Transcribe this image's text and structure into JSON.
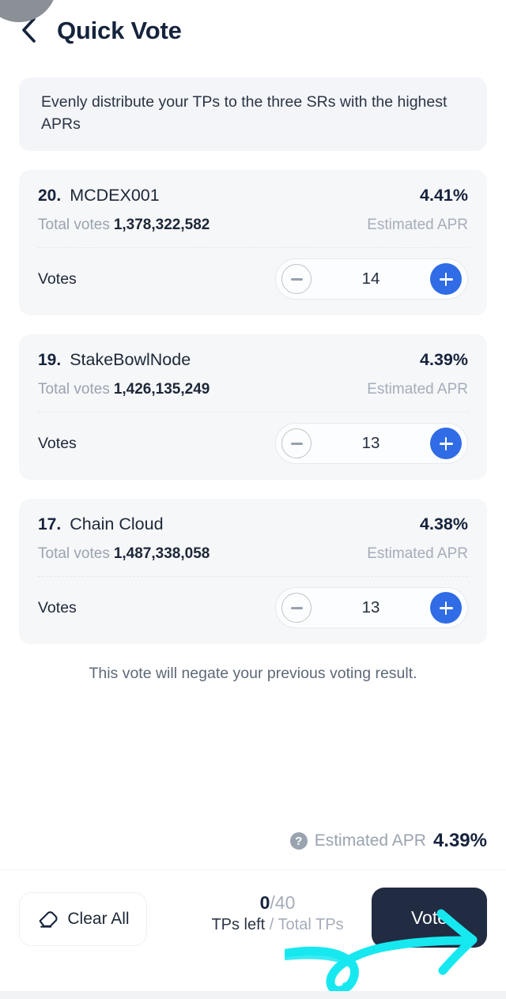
{
  "header": {
    "back_icon": "chevron-left-icon",
    "title": "Quick Vote"
  },
  "info_banner": {
    "text": "Evenly distribute your TPs to the three SRs with the highest APRs"
  },
  "sr_list": {
    "labels": {
      "total_votes": "Total votes",
      "estimated_apr": "Estimated APR",
      "votes": "Votes",
      "minus_icon": "minus-icon",
      "plus_icon": "plus-icon"
    },
    "items": [
      {
        "rank": "20.",
        "name": "MCDEX001",
        "apr": "4.41%",
        "total_votes": "1,378,322,582",
        "votes": "14"
      },
      {
        "rank": "19.",
        "name": "StakeBowlNode",
        "apr": "4.39%",
        "total_votes": "1,426,135,249",
        "votes": "13"
      },
      {
        "rank": "17.",
        "name": "Chain Cloud",
        "apr": "4.38%",
        "total_votes": "1,487,338,058",
        "votes": "13"
      }
    ]
  },
  "warning": {
    "text": "This vote will negate your previous voting result."
  },
  "apr_summary": {
    "help_icon": "question-mark-icon",
    "help_glyph": "?",
    "label": "Estimated APR",
    "value": "4.39%"
  },
  "bottom_bar": {
    "clear_all": {
      "label": "Clear All",
      "icon": "eraser-icon"
    },
    "tp": {
      "used": "0",
      "separator": "/",
      "total": "40",
      "legend_left": "TPs left",
      "legend_separator": " / ",
      "legend_right": "Total TPs"
    },
    "vote": {
      "label": "Vote"
    },
    "annotation": {
      "name": "cyan-arrow-annotation",
      "color": "#17e8f0"
    }
  },
  "colors": {
    "accent_blue": "#2f6ce5",
    "dark_navy": "#212c42",
    "title_navy": "#16233c",
    "muted_gray": "#9aa3b0",
    "card_bg": "#f6f7f9",
    "banner_bg": "#f3f5f8",
    "annotation_cyan": "#17e8f0"
  }
}
